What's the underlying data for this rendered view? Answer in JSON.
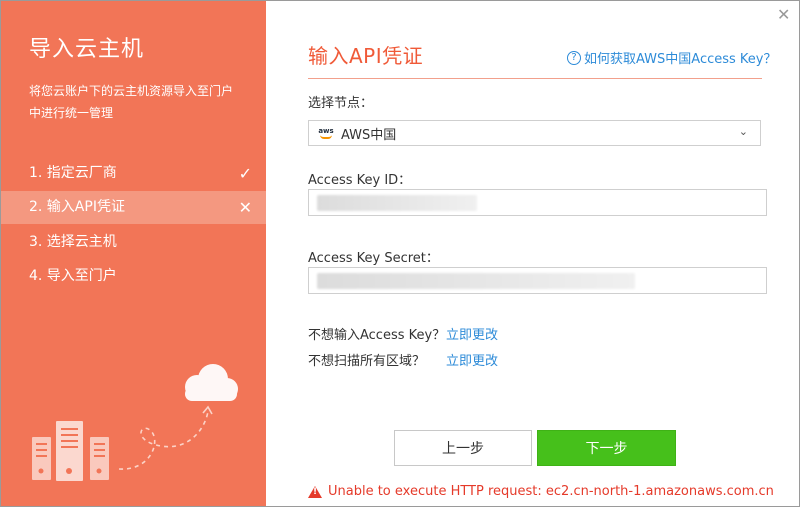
{
  "sidebar": {
    "title": "导入云主机",
    "description": "将您云账户下的云主机资源导入至门户中进行统一管理",
    "steps": [
      {
        "label": "1. 指定云厂商",
        "mark": "✓"
      },
      {
        "label": "2. 输入API凭证",
        "mark": "✕"
      },
      {
        "label": "3. 选择云主机",
        "mark": ""
      },
      {
        "label": "4. 导入至门户",
        "mark": ""
      }
    ]
  },
  "window": {
    "close": "✕"
  },
  "main": {
    "title": "输入API凭证",
    "help_link": "如何获取AWS中国Access Key？",
    "node_label": "选择节点：",
    "node_value": "AWS中国",
    "aws_logo_text": "aws",
    "access_key_id_label": "Access Key ID：",
    "access_key_secret_label": "Access Key Secret：",
    "no_access_key_text": "不想输入Access Key？",
    "no_access_key_link": "立即更改",
    "no_scan_text": "不想扫描所有区域？",
    "no_scan_link": "立即更改",
    "prev_button": "上一步",
    "next_button": "下一步",
    "error_message": "Unable to execute HTTP request: ec2.cn-north-1.amazonaws.com.cn"
  },
  "colors": {
    "sidebar_bg": "#f27557",
    "sidebar_active": "#f49880",
    "accent": "#f05a38",
    "link": "#2d8bd8",
    "primary_button": "#46c01b",
    "error": "#e53a2a"
  }
}
